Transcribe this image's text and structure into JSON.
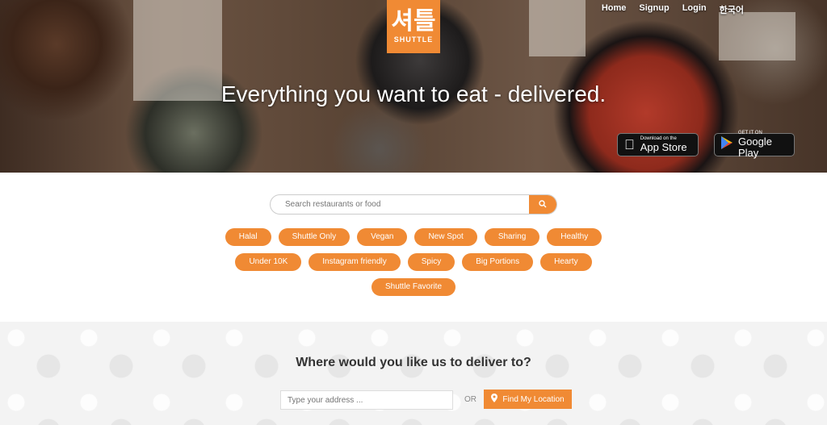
{
  "logo": {
    "korean": "셔틀",
    "english": "SHUTTLE"
  },
  "nav": {
    "home": "Home",
    "signup": "Signup",
    "login": "Login",
    "language": "한국어"
  },
  "hero": {
    "tagline": "Everything you want to eat - delivered."
  },
  "app_store": {
    "small": "Download on the",
    "big": "App Store",
    "icon": "apple-icon"
  },
  "google_play": {
    "small": "GET IT ON",
    "big": "Google Play",
    "icon": "play-icon"
  },
  "search": {
    "placeholder": "Search restaurants or food",
    "icon": "search-icon"
  },
  "tags": [
    [
      "Halal",
      "Shuttle Only",
      "Vegan",
      "New Spot",
      "Sharing",
      "Healthy"
    ],
    [
      "Under 10K",
      "Instagram friendly",
      "Spicy",
      "Big Portions",
      "Hearty"
    ],
    [
      "Shuttle Favorite"
    ]
  ],
  "deliver": {
    "heading": "Where would you like us to deliver to?",
    "address_placeholder": "Type your address ...",
    "or": "OR",
    "find_label": "Find My Location",
    "find_icon": "map-pin-icon"
  },
  "colors": {
    "accent": "#f08a34"
  }
}
